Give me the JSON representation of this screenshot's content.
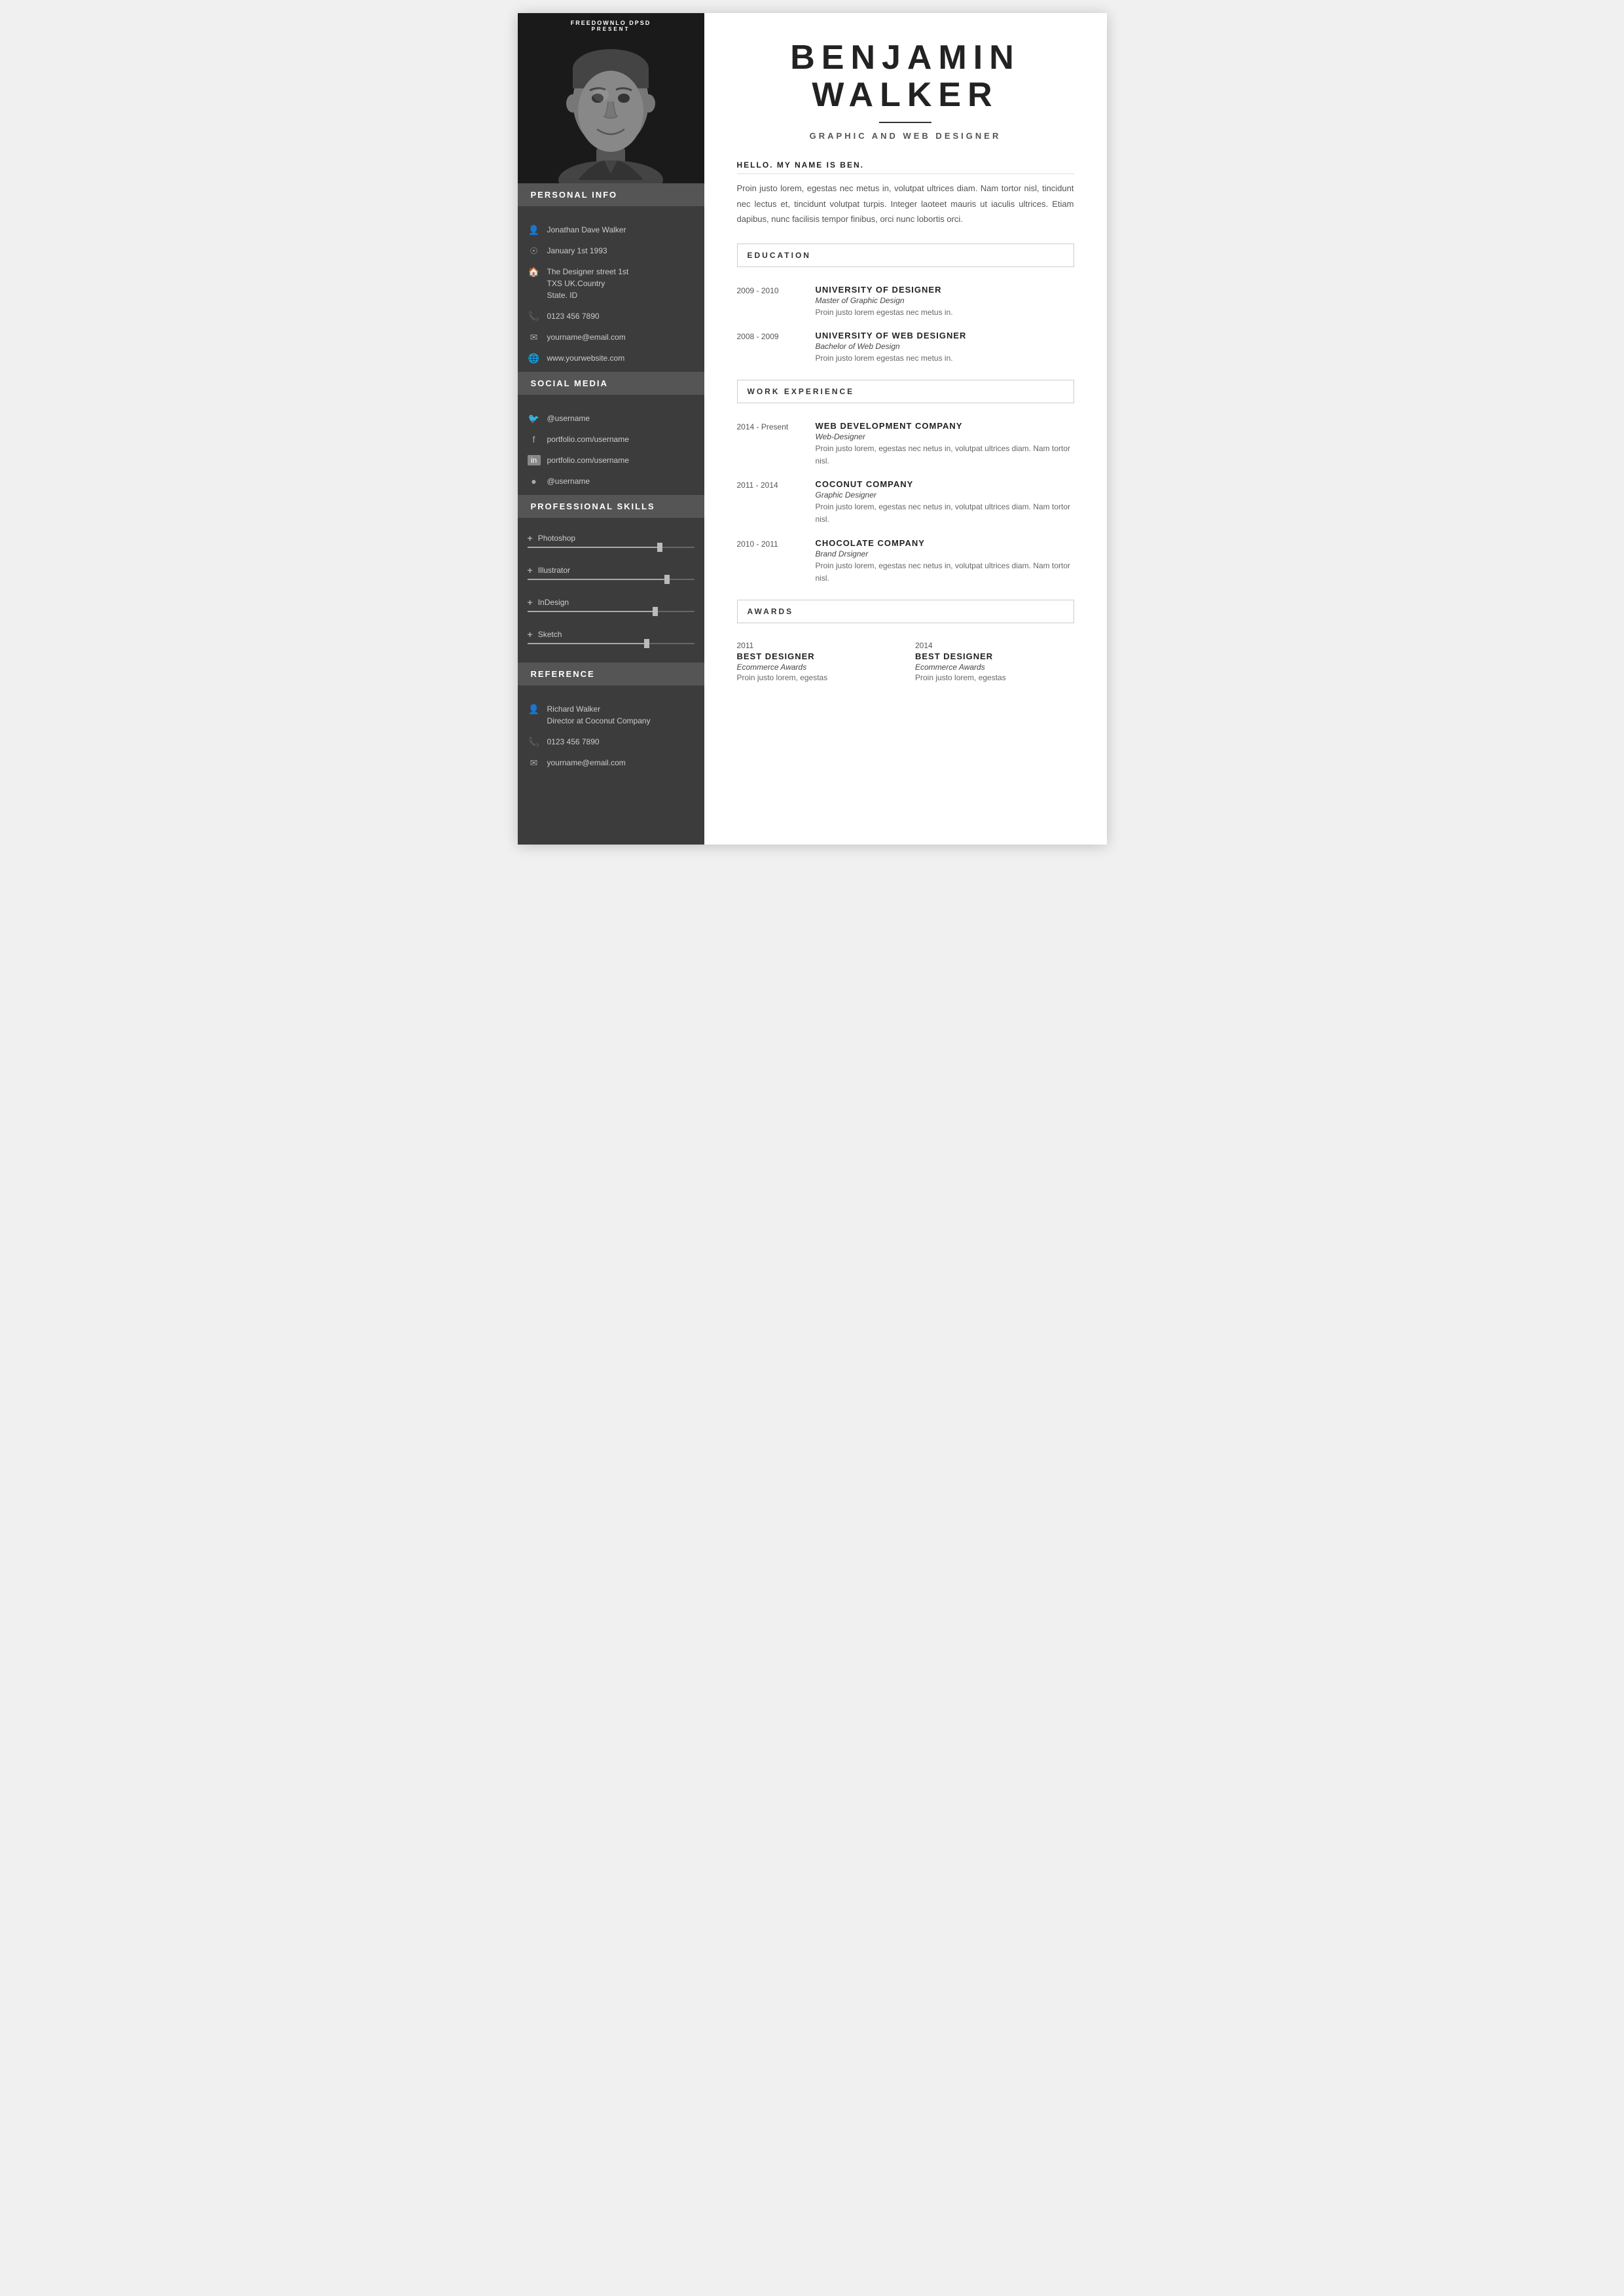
{
  "watermark": {
    "line1": "FREEDOWNLO DPSD",
    "line2": "PRESENT"
  },
  "sidebar": {
    "personal_title": "PERSONAL INFO",
    "name": "Jonathan Dave Walker",
    "dob": "January 1st 1993",
    "address_line1": "The Designer street 1st",
    "address_line2": "TXS UK.Country",
    "address_line3": "State. ID",
    "phone": "0123 456 7890",
    "email": "yourname@email.com",
    "website": "www.yourwebsite.com",
    "social_title": "SOCIAL MEDIA",
    "twitter": "@username",
    "facebook": "portfolio.com/username",
    "linkedin": "portfolio.com/username",
    "instagram": "@username",
    "skills_title": "PROFESSIONAL  SKILLS",
    "skills": [
      {
        "name": "Photoshop",
        "pct": 78
      },
      {
        "name": "Illustrator",
        "pct": 82
      },
      {
        "name": "InDesign",
        "pct": 75
      },
      {
        "name": "Sketch",
        "pct": 70
      }
    ],
    "reference_title": "REFERENCE",
    "ref_name": "Richard Walker",
    "ref_role": "Director at Coconut Company",
    "ref_phone": "0123 456 7890",
    "ref_email": "yourname@email.com"
  },
  "main": {
    "name_line1": "BENJAMIN",
    "name_line2": "WALKER",
    "job_title": "GRAPHIC AND WEB DESIGNER",
    "intro_label": "HELLO. MY NAME IS BEN.",
    "intro_text": "Proin justo lorem, egestas nec metus in, volutpat ultrices diam. Nam tortor nisl, tincidunt nec lectus et, tincidunt volutpat turpis. Integer laoteet mauris ut iaculis ultrices. Etiam dapibus, nunc facilisis tempor finibus, orci nunc lobortis orci.",
    "education_title": "EDUCATION",
    "education": [
      {
        "dates": "2009 - 2010",
        "school": "UNIVERSITY OF DESIGNER",
        "degree": "Master of Graphic Design",
        "desc": "Proin justo lorem egestas nec metus in."
      },
      {
        "dates": "2008 - 2009",
        "school": "UNIVERSITY OF WEB DESIGNER",
        "degree": "Bachelor of Web Design",
        "desc": "Proin justo lorem egestas nec metus in."
      }
    ],
    "work_title": "WORK EXPERIENCE",
    "work": [
      {
        "dates": "2014 - Present",
        "company": "WEB DEVELOPMENT COMPANY",
        "role": "Web-Designer",
        "desc": "Proin justo lorem, egestas nec netus in, volutpat ultrices diam. Nam tortor nisl."
      },
      {
        "dates": "2011 - 2014",
        "company": "COCONUT COMPANY",
        "role": "Graphic Designer",
        "desc": "Proin justo lorem, egestas nec netus in, volutpat ultrices diam. Nam tortor nisl."
      },
      {
        "dates": "2010 - 2011",
        "company": "CHOCOLATE  COMPANY",
        "role": "Brand Drsigner",
        "desc": "Proin justo lorem, egestas nec netus in, volutpat ultrices diam. Nam tortor nisl."
      }
    ],
    "awards_title": "AWARDS",
    "awards": [
      {
        "year": "2011",
        "title": "BEST  DESIGNER",
        "org": "Ecommerce Awards",
        "desc": "Proin justo  lorem, egestas"
      },
      {
        "year": "2014",
        "title": "BEST  DESIGNER",
        "org": "Ecommerce Awards",
        "desc": "Proin justo  lorem, egestas"
      }
    ]
  }
}
